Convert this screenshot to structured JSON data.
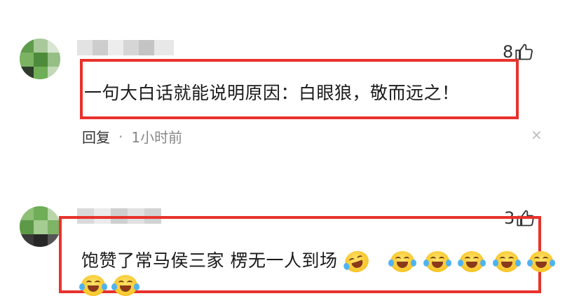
{
  "comments": [
    {
      "likes": "8",
      "text": "一句大白话就能说明原因：白眼狼，敬而远之！",
      "reply_label": "回复",
      "separator": "·",
      "time": "1小时前",
      "close_glyph": "×"
    },
    {
      "likes": "3",
      "text": "饱赞了常马侯三家 楞无一人到场",
      "emojis": [
        "crying-laughing",
        "tears-of-joy",
        "tears-of-joy",
        "tears-of-joy",
        "tears-of-joy",
        "tears-of-joy",
        "tears-of-joy",
        "tears-of-joy"
      ]
    }
  ],
  "colors": {
    "highlight_border": "#e8322c",
    "avatar_green": "#6fae57",
    "emoji_yellow": "#f7c629"
  },
  "icons": {
    "like": "thumbs-up-icon",
    "close": "close-icon"
  }
}
